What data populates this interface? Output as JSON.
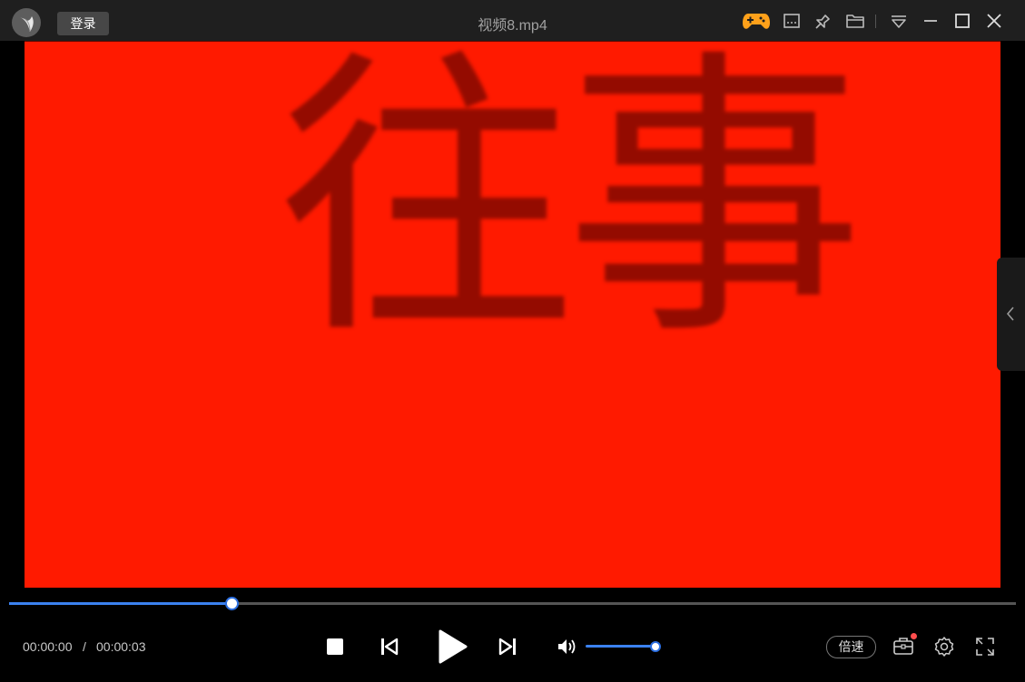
{
  "window": {
    "title": "视频8.mp4",
    "login_label": "登录"
  },
  "titlebar_icons": [
    {
      "name": "game-controller-icon",
      "color": "#ffa11a"
    },
    {
      "name": "screenshot-icon"
    },
    {
      "name": "pin-icon"
    },
    {
      "name": "folder-icon"
    },
    {
      "name": "menu-dropdown-icon"
    },
    {
      "name": "minimize-icon"
    },
    {
      "name": "maximize-icon"
    },
    {
      "name": "close-icon"
    }
  ],
  "video": {
    "background_color": "#ff1a00",
    "text_glyph_1": "往",
    "text_glyph_2": "事"
  },
  "playback": {
    "progress_fraction": 0.221,
    "current_time": "00:00:00",
    "separator": "/",
    "total_time": "00:00:03",
    "volume_fraction": 1.0,
    "speed_label": "倍速",
    "accent_color": "#3b82f0"
  }
}
